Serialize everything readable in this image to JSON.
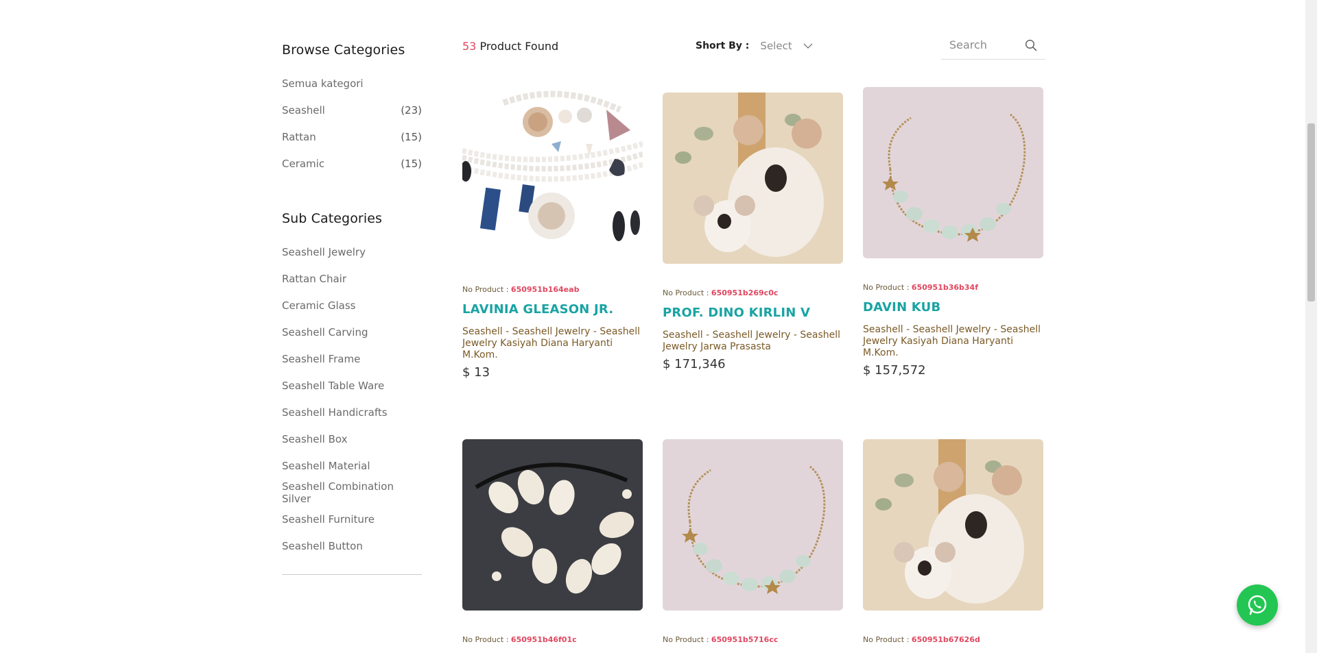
{
  "sidebar": {
    "browse_title": "Browse Categories",
    "categories": [
      {
        "label": "Semua kategori",
        "count": ""
      },
      {
        "label": "Seashell",
        "count": "(23)"
      },
      {
        "label": "Rattan",
        "count": "(15)"
      },
      {
        "label": "Ceramic",
        "count": "(15)"
      }
    ],
    "sub_title": "Sub Categories",
    "sub_categories": [
      "Seashell Jewelry",
      "Rattan Chair",
      "Ceramic Glass",
      "Seashell Carving",
      "Seashell Frame",
      "Seashell Table Ware",
      "Seashell Handicrafts",
      "Seashell Box",
      "Seashell Material",
      "Seashell Combination Silver",
      "Seashell Furniture",
      "Seashell Button"
    ]
  },
  "toolbar": {
    "count": "53",
    "found_label": " Product Found",
    "sort_label": "Short By :",
    "sort_value": "Select",
    "search_placeholder": "Search"
  },
  "products": [
    {
      "code_label": "No Product : ",
      "code": "650951b164eab",
      "name": "LAVINIA GLEASON JR.",
      "desc": "Seashell - Seashell Jewelry - Seashell Jewelry Kasiyah Diana Haryanti M.Kom.",
      "price": "$ 13",
      "image": "pearls-shell-materials"
    },
    {
      "code_label": "No Product : ",
      "code": "650951b269c0c",
      "name": "PROF. DINO KIRLIN V",
      "desc": "Seashell - Seashell Jewelry - Seashell Jewelry Jarwa Prasasta",
      "price": "$ 171,346",
      "image": "shell-koala"
    },
    {
      "code_label": "No Product : ",
      "code": "650951b36b34f",
      "name": "DAVIN KUB",
      "desc": "Seashell - Seashell Jewelry - Seashell Jewelry Kasiyah Diana Haryanti M.Kom.",
      "price": "$ 157,572",
      "image": "shell-necklace"
    },
    {
      "code_label": "No Product : ",
      "code": "650951b46f01c",
      "name": "",
      "desc": "",
      "price": "",
      "image": "cowrie-bracelet"
    },
    {
      "code_label": "No Product : ",
      "code": "650951b5716cc",
      "name": "",
      "desc": "",
      "price": "",
      "image": "shell-necklace"
    },
    {
      "code_label": "No Product : ",
      "code": "650951b67626d",
      "name": "",
      "desc": "",
      "price": "",
      "image": "shell-koala"
    }
  ],
  "whatsapp": {
    "icon": "whatsapp-icon",
    "color": "#23c653"
  },
  "colors": {
    "accent": "#e0465f",
    "product_name": "#1aa3a3",
    "description": "#7a5a26"
  }
}
